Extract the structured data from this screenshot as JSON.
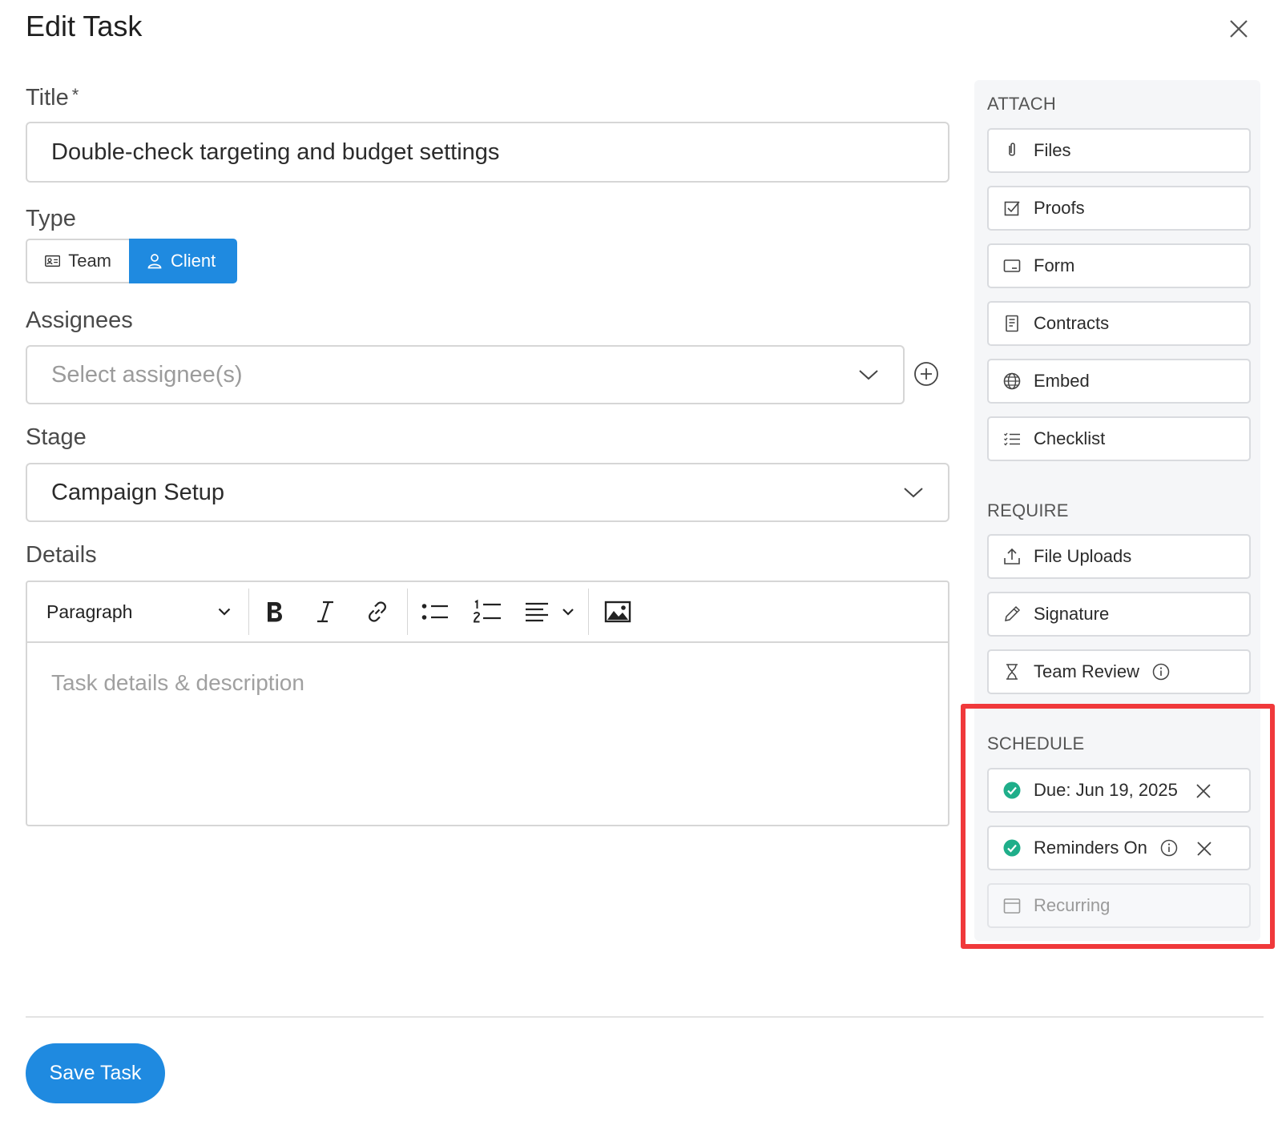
{
  "modal": {
    "title": "Edit Task"
  },
  "title_field": {
    "label": "Title",
    "required_mark": "*",
    "value": "Double-check targeting and budget settings"
  },
  "type_field": {
    "label": "Type",
    "options": [
      {
        "label": "Team",
        "selected": false
      },
      {
        "label": "Client",
        "selected": true
      }
    ]
  },
  "assignees_field": {
    "label": "Assignees",
    "placeholder": "Select assignee(s)"
  },
  "stage_field": {
    "label": "Stage",
    "value": "Campaign Setup"
  },
  "details_field": {
    "label": "Details",
    "format_select": "Paragraph",
    "placeholder": "Task details & description"
  },
  "attach": {
    "title": "ATTACH",
    "items": [
      {
        "label": "Files",
        "icon": "paperclip-icon"
      },
      {
        "label": "Proofs",
        "icon": "checkbox-icon"
      },
      {
        "label": "Form",
        "icon": "form-icon"
      },
      {
        "label": "Contracts",
        "icon": "document-icon"
      },
      {
        "label": "Embed",
        "icon": "globe-icon"
      },
      {
        "label": "Checklist",
        "icon": "checklist-icon"
      }
    ]
  },
  "require": {
    "title": "REQUIRE",
    "items": [
      {
        "label": "File Uploads",
        "icon": "upload-icon"
      },
      {
        "label": "Signature",
        "icon": "pen-icon"
      },
      {
        "label": "Team Review",
        "icon": "hourglass-icon"
      }
    ]
  },
  "schedule": {
    "title": "SCHEDULE",
    "items": [
      {
        "label": "Due: Jun 19, 2025",
        "icon": "check-circle-icon",
        "active": true
      },
      {
        "label": "Reminders On",
        "icon": "check-circle-icon",
        "active": true
      },
      {
        "label": "Recurring",
        "icon": "calendar-icon",
        "active": false
      }
    ]
  },
  "colors": {
    "accent": "#1f8ae0",
    "success": "#1fae8a",
    "highlight": "#f0393b"
  },
  "footer": {
    "save_label": "Save Task"
  }
}
